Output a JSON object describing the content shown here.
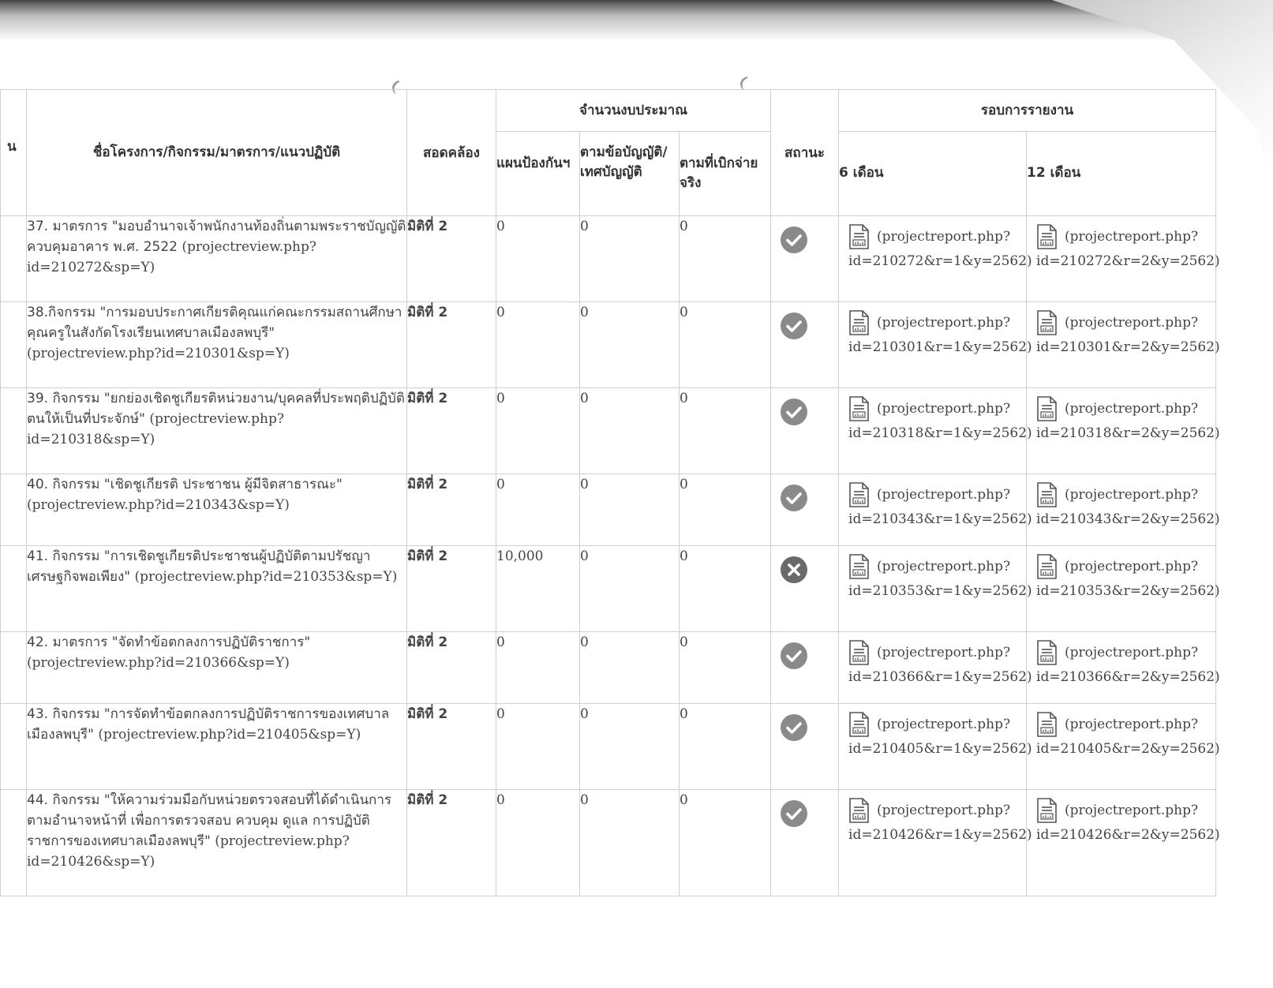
{
  "header": {
    "cut_first_col": "น",
    "project_col": "ชื่อโครงการ/กิจกรรม/มาตรการ/แนวปฏิบัติ",
    "alignment_col": "สอดคล้อง",
    "budget_group": "จำนวนงบประมาณ",
    "budget_plan": "แผนป้องกันฯ",
    "budget_law": "ตามข้อบัญญัติ/เทศบัญญัติ",
    "budget_actual": "ตามที่เบิกจ่ายจริง",
    "status_col": "สถานะ",
    "report_group": "รอบการรายงาน",
    "report_6": "6 เดือน",
    "report_12": "12 เดือน"
  },
  "rows": [
    {
      "title": "37. มาตรการ \"มอบอำนาจเจ้าพนักงานท้องถิ่นตามพระราชบัญญัติควบคุมอาคาร พ.ศ. 2522",
      "link": "(projectreview.php?id=210272&sp=Y)",
      "dimension": "มิติที่ 2",
      "plan": "0",
      "law": "0",
      "actual": "0",
      "status": "done",
      "r6a": "(projectreport.php?",
      "r6b": "id=210272&r=1&y=2562)",
      "r12a": "(projectreport.php?",
      "r12b": "id=210272&r=2&y=2562)"
    },
    {
      "title": "38.กิจกรรม \"การมอบประกาศเกียรติคุณแก่คณะกรรมสถานศึกษา คุณครูในสังกัดโรงเรียนเทศบาลเมืองลพบุรี\"",
      "link": "(projectreview.php?id=210301&sp=Y)",
      "dimension": "มิติที่ 2",
      "plan": "0",
      "law": "0",
      "actual": "0",
      "status": "done",
      "r6a": "(projectreport.php?",
      "r6b": "id=210301&r=1&y=2562)",
      "r12a": "(projectreport.php?",
      "r12b": "id=210301&r=2&y=2562)"
    },
    {
      "title": "39. กิจกรรม \"ยกย่องเชิดชูเกียรติหน่วยงาน/บุคคลที่ประพฤติปฏิบัติตนให้เป็นที่ประจักษ์\"",
      "link": "(projectreview.php?id=210318&sp=Y)",
      "dimension": "มิติที่ 2",
      "plan": "0",
      "law": "0",
      "actual": "0",
      "status": "done",
      "r6a": "(projectreport.php?",
      "r6b": "id=210318&r=1&y=2562)",
      "r12a": "(projectreport.php?",
      "r12b": "id=210318&r=2&y=2562)"
    },
    {
      "title": "40. กิจกรรม \"เชิดชูเกียรติ ประชาชน ผู้มีจิตสาธารณะ\"",
      "link": "(projectreview.php?id=210343&sp=Y)",
      "dimension": "มิติที่ 2",
      "plan": "0",
      "law": "0",
      "actual": "0",
      "status": "done",
      "r6a": "(projectreport.php?",
      "r6b": "id=210343&r=1&y=2562)",
      "r12a": "(projectreport.php?",
      "r12b": "id=210343&r=2&y=2562)"
    },
    {
      "title": "41. กิจกรรม \"การเชิดชูเกียรติประชาชนผู้ปฏิบัติตามปรัชญาเศรษฐกิจพอเพียง\"",
      "link": "(projectreview.php?id=210353&sp=Y)",
      "dimension": "มิติที่ 2",
      "plan": "10,000",
      "law": "0",
      "actual": "0",
      "status": "not-done",
      "r6a": "(projectreport.php?",
      "r6b": "id=210353&r=1&y=2562)",
      "r12a": "(projectreport.php?",
      "r12b": "id=210353&r=2&y=2562)"
    },
    {
      "title": "42. มาตรการ \"จัดทำข้อตกลงการปฏิบัติราชการ\"",
      "link": "(projectreview.php?id=210366&sp=Y)",
      "dimension": "มิติที่ 2",
      "plan": "0",
      "law": "0",
      "actual": "0",
      "status": "done",
      "r6a": "(projectreport.php?",
      "r6b": "id=210366&r=1&y=2562)",
      "r12a": "(projectreport.php?",
      "r12b": "id=210366&r=2&y=2562)"
    },
    {
      "title": "43. กิจกรรม \"การจัดทำข้อตกลงการปฏิบัติราชการของเทศบาลเมืองลพบุรี\"",
      "link": "(projectreview.php?id=210405&sp=Y)",
      "dimension": "มิติที่ 2",
      "plan": "0",
      "law": "0",
      "actual": "0",
      "status": "done",
      "r6a": "(projectreport.php?",
      "r6b": "id=210405&r=1&y=2562)",
      "r12a": "(projectreport.php?",
      "r12b": "id=210405&r=2&y=2562)"
    },
    {
      "title": "44. กิจกรรม \"ให้ความร่วมมือกับหน่วยตรวจสอบที่ได้ดำเนินการตามอำนาจหน้าที่ เพื่อการตรวจสอบ ควบคุม ดูแล การปฏิบัติราชการของเทศบาลเมืองลพบุรี\"",
      "link": "(projectreview.php?id=210426&sp=Y)",
      "dimension": "มิติที่ 2",
      "plan": "0",
      "law": "0",
      "actual": "0",
      "status": "done",
      "r6a": "(projectreport.php?",
      "r6b": "id=210426&r=1&y=2562)",
      "r12a": "(projectreport.php?",
      "r12b": "id=210426&r=2&y=2562)"
    }
  ]
}
